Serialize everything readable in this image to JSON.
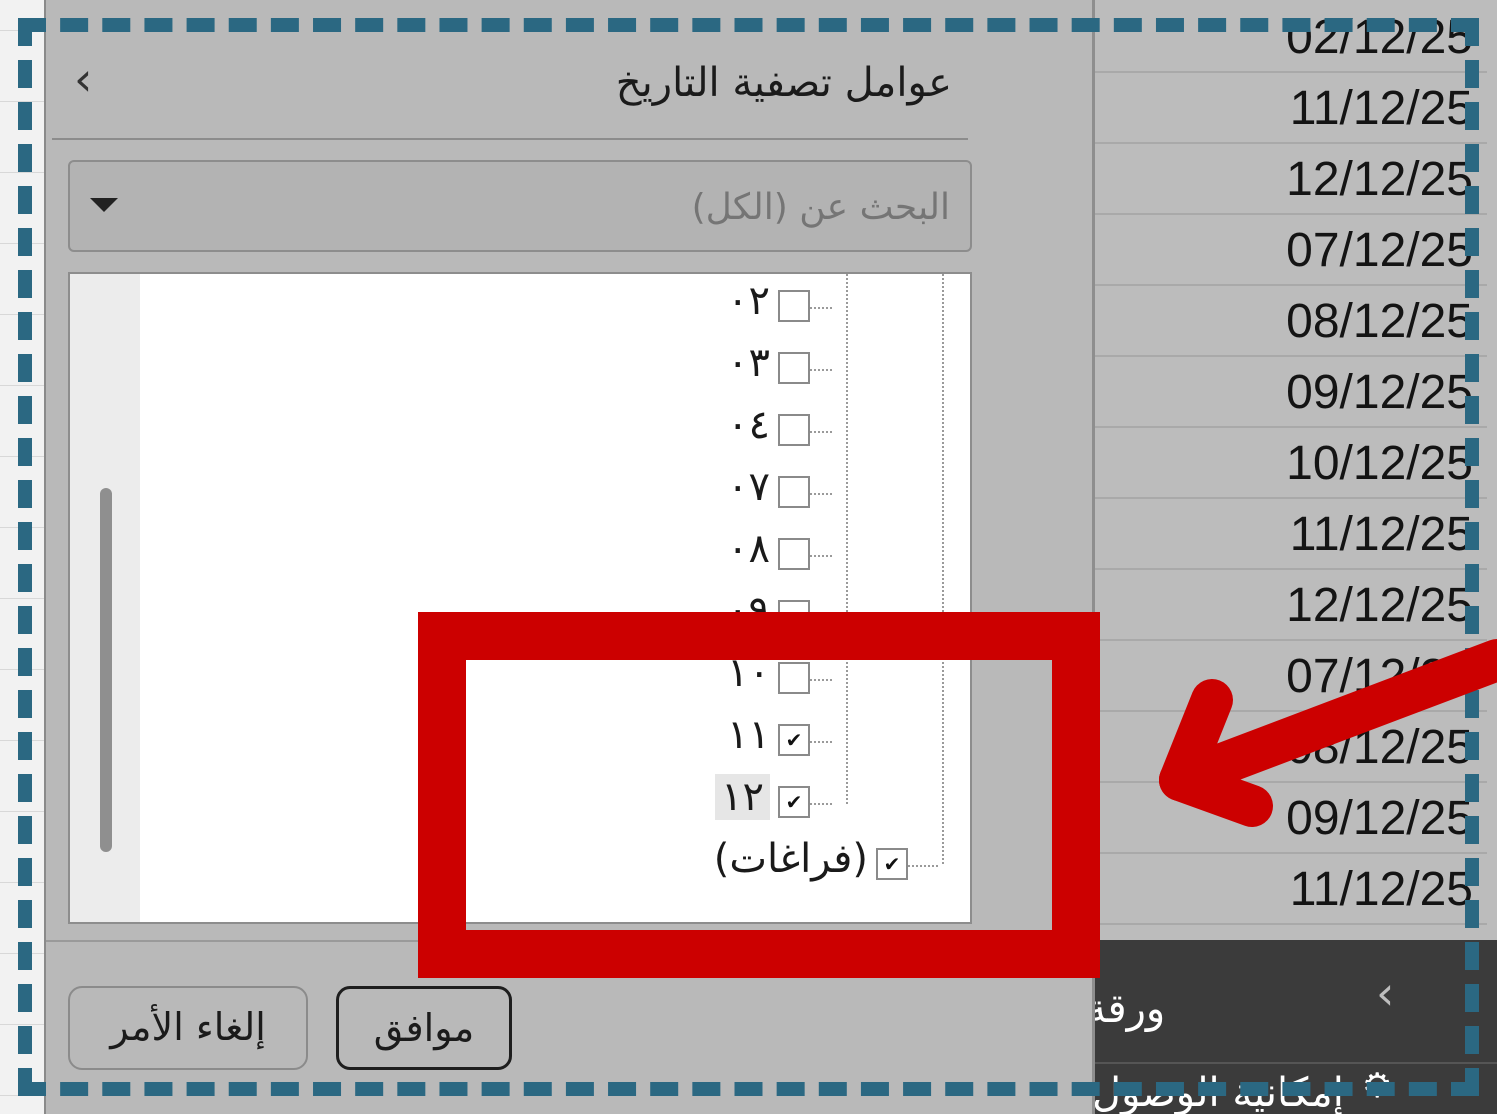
{
  "dialog": {
    "title": "عوامل تصفية التاريخ",
    "back_icon": "chevron-left-icon",
    "search": {
      "placeholder": "البحث عن (الكل)",
      "value": ""
    },
    "items": [
      {
        "label": "٠٢",
        "checked": false
      },
      {
        "label": "٠٣",
        "checked": false
      },
      {
        "label": "٠٤",
        "checked": false
      },
      {
        "label": "٠٧",
        "checked": false
      },
      {
        "label": "٠٨",
        "checked": false
      },
      {
        "label": "٠٩",
        "checked": false
      },
      {
        "label": "١٠",
        "checked": false
      },
      {
        "label": "١١",
        "checked": true
      },
      {
        "label": "١٢",
        "checked": true
      },
      {
        "label": "(فراغات)",
        "checked": true
      }
    ],
    "ok_label": "موافق",
    "cancel_label": "إلغاء الأمر"
  },
  "sheet": {
    "dates": [
      "02/12/25",
      "11/12/25",
      "12/12/25",
      "07/12/25",
      "08/12/25",
      "09/12/25",
      "10/12/25",
      "11/12/25",
      "12/12/25",
      "07/12/25",
      "08/12/25",
      "09/12/25",
      "11/12/25"
    ]
  },
  "sheet_tabs": {
    "tab_label": "ورقة",
    "nav_icon": "chevron-left-icon",
    "accessibility_label": "إمكانية الوصول"
  },
  "annotation": {
    "frame_color": "#2b6882",
    "highlight_color": "#cc0000"
  }
}
